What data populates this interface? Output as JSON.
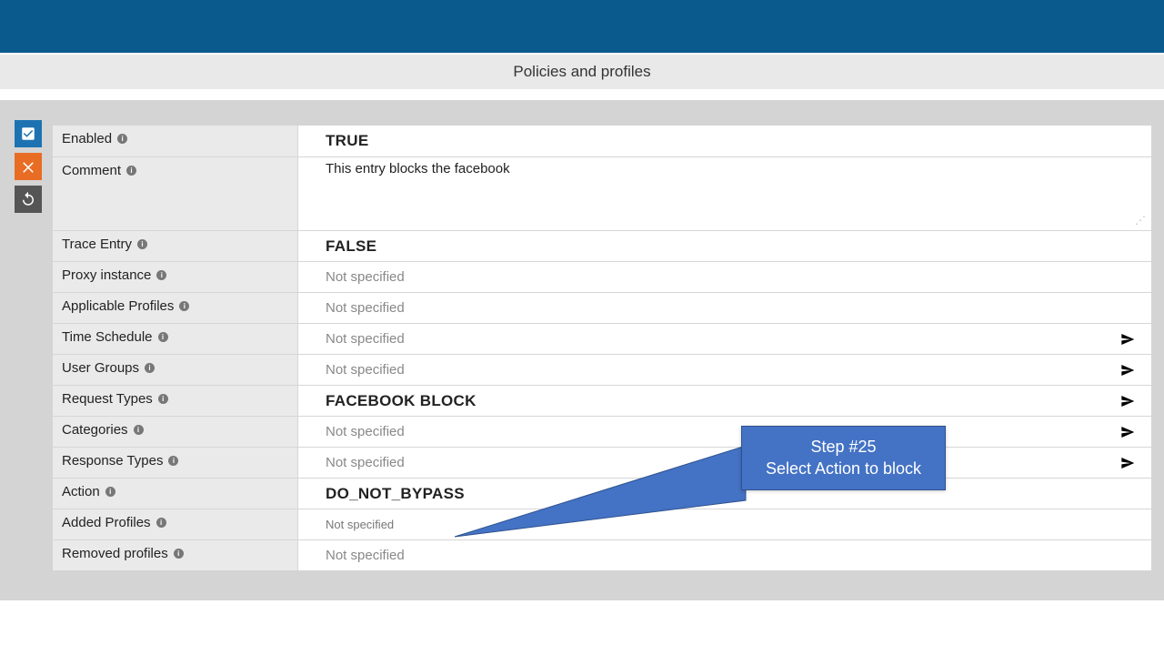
{
  "header": {
    "title": "Policies and profiles"
  },
  "rows": {
    "enabled": {
      "label": "Enabled",
      "value": "TRUE"
    },
    "comment": {
      "label": "Comment",
      "value": "This entry blocks the facebook"
    },
    "trace": {
      "label": "Trace Entry",
      "value": "FALSE"
    },
    "proxy": {
      "label": "Proxy instance",
      "value": "Not specified"
    },
    "appprofiles": {
      "label": "Applicable Profiles",
      "value": "Not specified"
    },
    "schedule": {
      "label": "Time Schedule",
      "value": "Not specified"
    },
    "usergroups": {
      "label": "User Groups",
      "value": "Not specified"
    },
    "reqtypes": {
      "label": "Request Types",
      "value": "FACEBOOK BLOCK"
    },
    "categories": {
      "label": "Categories",
      "value": "Not specified"
    },
    "resptypes": {
      "label": "Response Types",
      "value": "Not specified"
    },
    "action": {
      "label": "Action",
      "value": "DO_NOT_BYPASS"
    },
    "addedprofiles": {
      "label": "Added Profiles",
      "value": "Not specified"
    },
    "removedprofiles": {
      "label": "Removed profiles",
      "value": "Not specified"
    }
  },
  "callout": {
    "line1": "Step #25",
    "line2": "Select Action to block"
  }
}
